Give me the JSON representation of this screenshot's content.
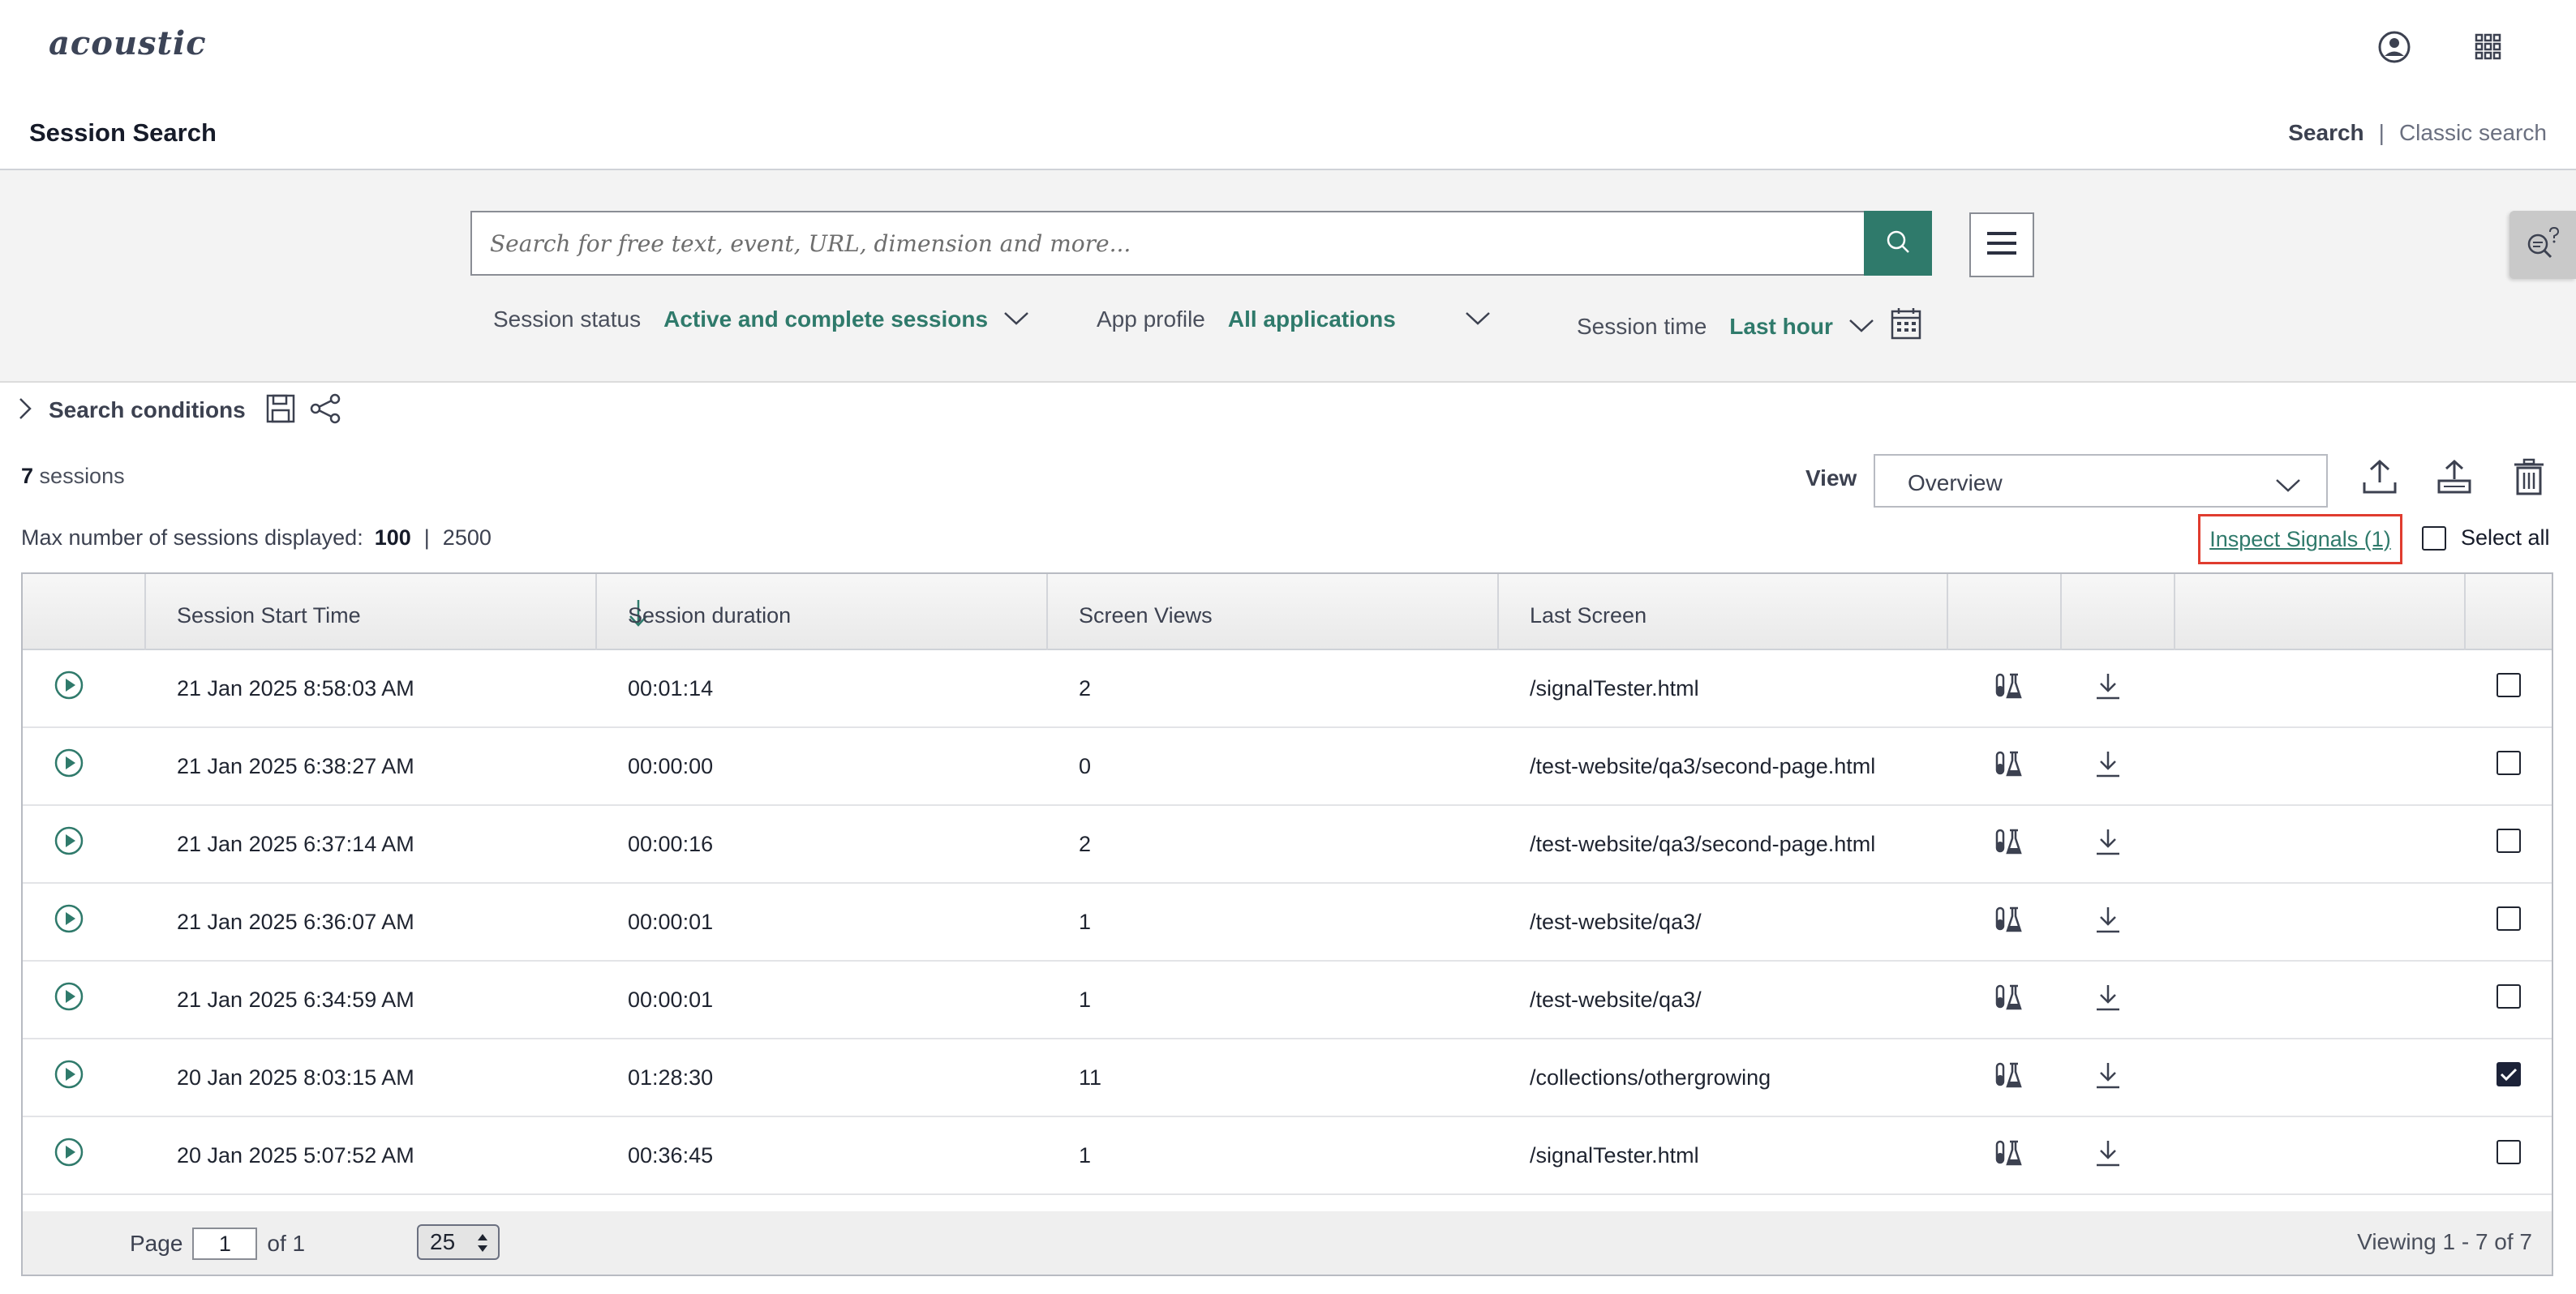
{
  "brand": {
    "logo": "acoustic"
  },
  "header": {
    "title": "Session Search",
    "links": {
      "search": "Search",
      "separator": "|",
      "classic": "Classic search"
    }
  },
  "search": {
    "placeholder": "Search for free text, event, URL, dimension and more...",
    "value": ""
  },
  "filters": {
    "session_status": {
      "label": "Session status",
      "value": "Active and complete sessions"
    },
    "app_profile": {
      "label": "App profile",
      "value": "All applications"
    },
    "session_time": {
      "label": "Session time",
      "value": "Last hour"
    }
  },
  "conditions": {
    "label": "Search conditions"
  },
  "results": {
    "count": "7",
    "count_suffix": "sessions",
    "view_label": "View",
    "view_value": "Overview",
    "max_label": "Max number of sessions displayed:",
    "max_option_selected": "100",
    "max_separator": "|",
    "max_option_other": "2500",
    "inspect_link": "Inspect Signals (1)",
    "select_all": "Select all"
  },
  "table": {
    "columns": [
      "Session Start Time",
      "Session duration",
      "Screen Views",
      "Last Screen"
    ],
    "rows": [
      {
        "start": "21 Jan 2025 8:58:03 AM",
        "duration": "00:01:14",
        "views": "2",
        "last": "/signalTester.html",
        "checked": false
      },
      {
        "start": "21 Jan 2025 6:38:27 AM",
        "duration": "00:00:00",
        "views": "0",
        "last": "/test-website/qa3/second-page.html",
        "checked": false
      },
      {
        "start": "21 Jan 2025 6:37:14 AM",
        "duration": "00:00:16",
        "views": "2",
        "last": "/test-website/qa3/second-page.html",
        "checked": false
      },
      {
        "start": "21 Jan 2025 6:36:07 AM",
        "duration": "00:00:01",
        "views": "1",
        "last": "/test-website/qa3/",
        "checked": false
      },
      {
        "start": "21 Jan 2025 6:34:59 AM",
        "duration": "00:00:01",
        "views": "1",
        "last": "/test-website/qa3/",
        "checked": false
      },
      {
        "start": "20 Jan 2025 8:03:15 AM",
        "duration": "01:28:30",
        "views": "11",
        "last": "/collections/othergrowing",
        "checked": true
      },
      {
        "start": "20 Jan 2025 5:07:52 AM",
        "duration": "00:36:45",
        "views": "1",
        "last": "/signalTester.html",
        "checked": false
      }
    ]
  },
  "footer": {
    "page_label": "Page",
    "page_value": "1",
    "of_label": "of 1",
    "page_size": "25",
    "viewing": "Viewing 1 - 7 of 7"
  },
  "icons": {
    "user": "user-circle-icon",
    "apps": "app-grid-icon",
    "search": "search-icon",
    "menu": "hamburger-menu-icon",
    "help": "search-help-icon",
    "calendar": "calendar-icon",
    "save": "save-icon",
    "share": "share-icon",
    "export": "export-icon",
    "upload": "upload-icon",
    "delete": "trash-icon",
    "play": "play-circle-icon",
    "lab": "lab-flask-icon",
    "download": "download-icon",
    "sort": "sort-descending-arrow-icon"
  },
  "colors": {
    "accent": "#2f7a6b",
    "highlight_border": "#e03c2f",
    "text_dark": "#161b29",
    "checkbox_checked": "#1c2238"
  }
}
